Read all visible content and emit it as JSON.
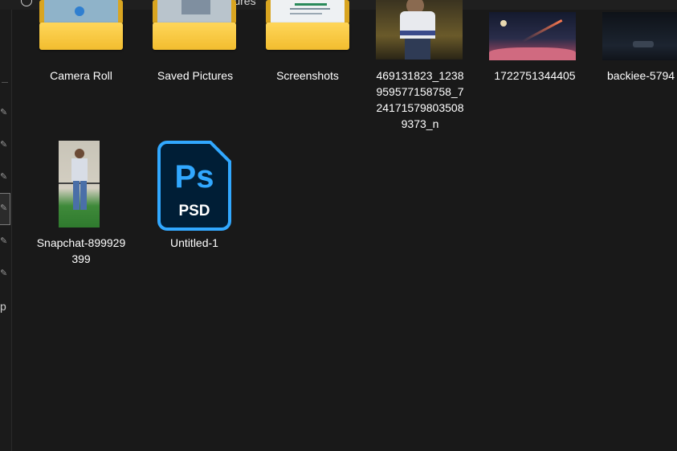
{
  "header": {
    "breadcrumb_partial": "Pictures"
  },
  "sidebar": {
    "partial_label": "p"
  },
  "items": [
    {
      "name": "Camera Roll",
      "type": "folder"
    },
    {
      "name": "Saved Pictures",
      "type": "folder"
    },
    {
      "name": "Screenshots",
      "type": "folder"
    },
    {
      "name": "469131823_1238959577158758_7241715798035089373_n",
      "type": "image",
      "display_lines": [
        "469131823_1238",
        "959577158758_7",
        "24171579803508",
        "9373_n"
      ]
    },
    {
      "name": "1722751344405",
      "type": "image"
    },
    {
      "name": "backiee-5794",
      "type": "image"
    },
    {
      "name": "Snapchat-899929399",
      "type": "image",
      "display_lines": [
        "Snapchat-899929",
        "399"
      ]
    },
    {
      "name": "Untitled-1",
      "type": "psd",
      "icon_text": "Ps",
      "icon_subtext": "PSD"
    }
  ],
  "colors": {
    "background": "#191919",
    "folder": "#f5c842",
    "psd_blue": "#31a8ff",
    "psd_bg": "#001e36"
  }
}
